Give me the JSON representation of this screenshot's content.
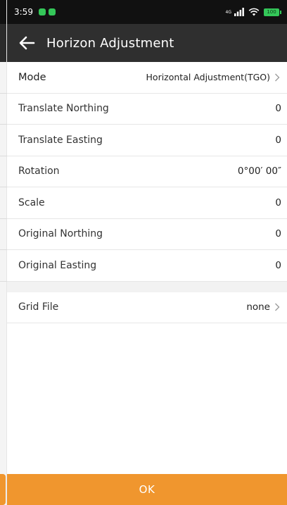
{
  "status_bar": {
    "time": "3:59",
    "signal_label": "4G",
    "battery": "100"
  },
  "toolbar": {
    "title": "Horizon Adjustment",
    "back_icon": "arrow-left-icon"
  },
  "mode": {
    "label": "Mode",
    "value": "Horizontal Adjustment(TGO)"
  },
  "fields": [
    {
      "label": "Translate Northing",
      "value": "0"
    },
    {
      "label": "Translate Easting",
      "value": "0"
    },
    {
      "label": "Rotation",
      "value": "0°00′ 00″"
    },
    {
      "label": "Scale",
      "value": "0"
    },
    {
      "label": "Original Northing",
      "value": "0"
    },
    {
      "label": "Original Easting",
      "value": "0"
    }
  ],
  "grid_file": {
    "label": "Grid File",
    "value": "none"
  },
  "ok_label": "OK",
  "colors": {
    "accent": "#f0962e",
    "toolbar": "#2f2f2f",
    "statusbar": "#111111"
  }
}
